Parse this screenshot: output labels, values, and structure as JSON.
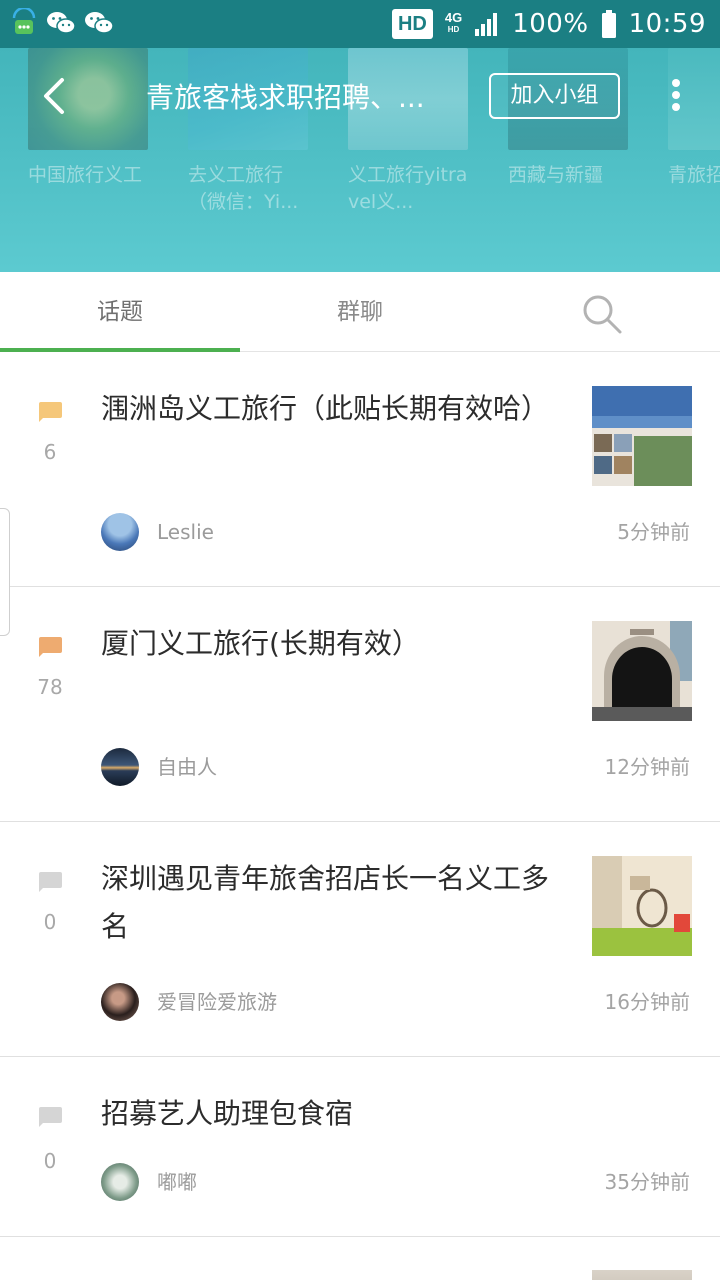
{
  "status_bar": {
    "hd": "HD",
    "network": "4G",
    "network_sub": "HD",
    "battery": "100%",
    "time": "10:59"
  },
  "header": {
    "title": "青旅客栈求职招聘、...",
    "join_label": "加入小组",
    "related_groups": [
      {
        "name": "中国旅行义工"
      },
      {
        "name": "去义工旅行（微信：Yi..."
      },
      {
        "name": "义工旅行yitravel义..."
      },
      {
        "name": "西藏与新疆"
      },
      {
        "name": "青旅招应聘专"
      }
    ]
  },
  "tabs": {
    "topics": "话题",
    "group_chat": "群聊"
  },
  "topics": [
    {
      "title": "涠洲岛义工旅行（此贴长期有效哈）",
      "comments": "6",
      "author": "Leslie",
      "time": "5分钟前",
      "icon_color": "#f5c77a"
    },
    {
      "title": "厦门义工旅行(长期有效）",
      "comments": "78",
      "author": "自由人",
      "time": "12分钟前",
      "icon_color": "#eeab70"
    },
    {
      "title": "深圳遇见青年旅舍招店长一名义工多名",
      "comments": "0",
      "author": "爱冒险爱旅游",
      "time": "16分钟前",
      "icon_color": "#d5d5d5"
    },
    {
      "title": "招募艺人助理包食宿",
      "comments": "0",
      "author": "嘟嘟",
      "time": "35分钟前",
      "icon_color": "#d5d5d5"
    }
  ],
  "icons": {
    "back": "back-arrow-icon",
    "more": "more-vertical-icon",
    "search": "search-icon",
    "comment": "comment-bubble-icon"
  },
  "colors": {
    "status_bar": "#1b7f83",
    "header": "#4cbfc5",
    "tab_accent": "#4cb050"
  }
}
